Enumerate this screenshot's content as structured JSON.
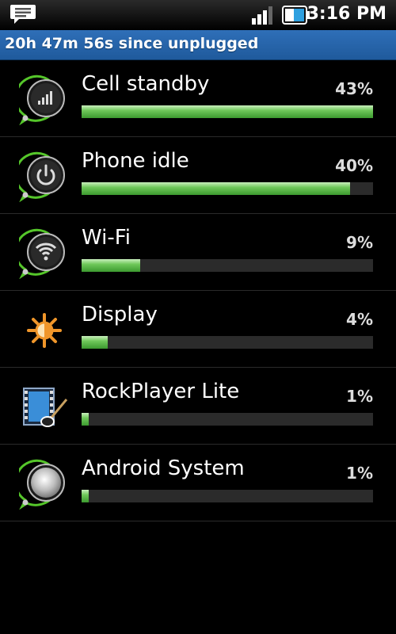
{
  "statusbar": {
    "time": "3:16 PM",
    "signal_level": 0.75,
    "battery_level": 0.6
  },
  "header": {
    "title": "20h 47m 56s since unplugged"
  },
  "items": [
    {
      "name": "Cell standby",
      "percent": "43%",
      "bar_fraction": 1.0,
      "icon": "signal-bars-icon"
    },
    {
      "name": "Phone idle",
      "percent": "40%",
      "bar_fraction": 0.92,
      "icon": "power-icon"
    },
    {
      "name": "Wi-Fi",
      "percent": "9%",
      "bar_fraction": 0.2,
      "icon": "wifi-icon"
    },
    {
      "name": "Display",
      "percent": "4%",
      "bar_fraction": 0.09,
      "icon": "brightness-icon"
    },
    {
      "name": "RockPlayer Lite",
      "percent": "1%",
      "bar_fraction": 0.025,
      "icon": "rockplayer-app-icon"
    },
    {
      "name": "Android System",
      "percent": "1%",
      "bar_fraction": 0.025,
      "icon": "android-system-icon"
    }
  ]
}
